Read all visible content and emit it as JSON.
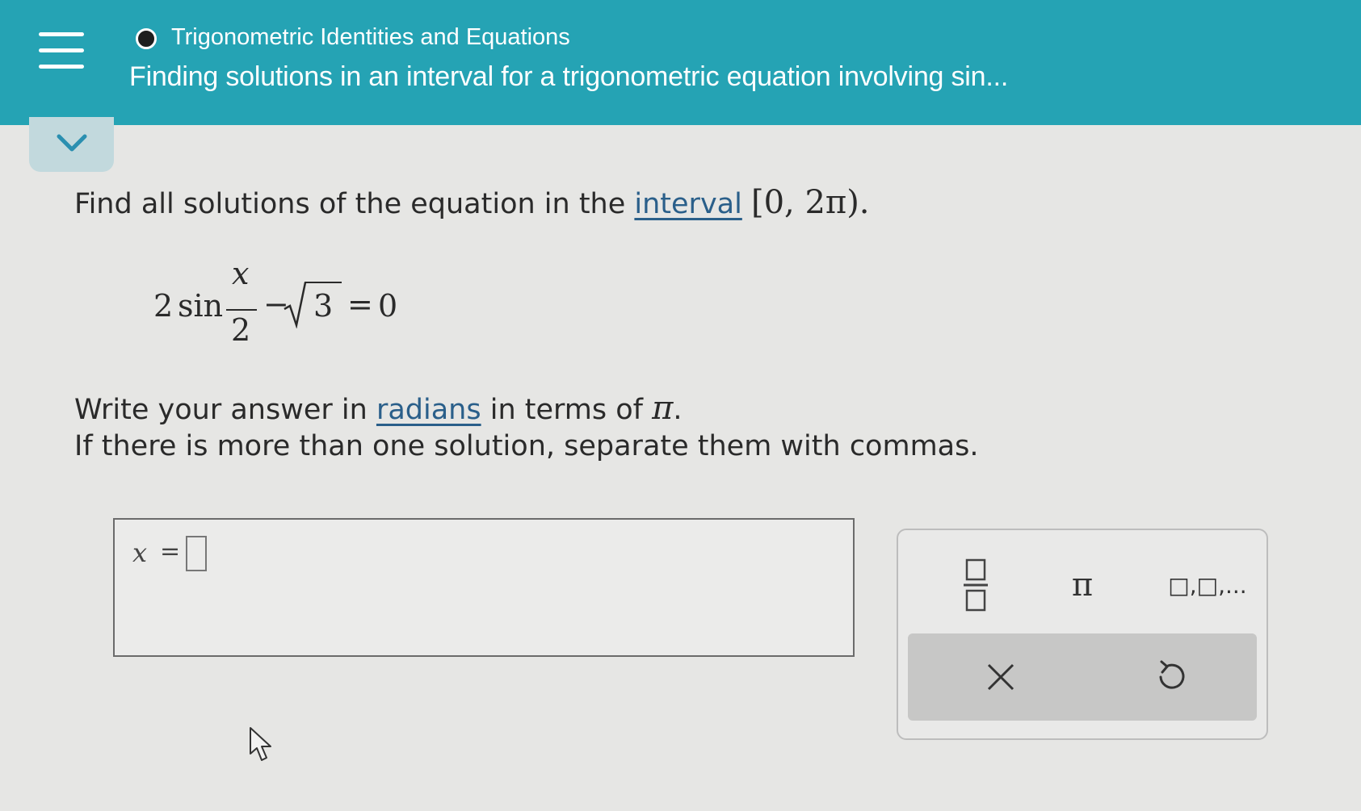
{
  "header": {
    "topic": "Trigonometric Identities and Equations",
    "lesson": "Finding solutions in an interval for a trigonometric equation involving sin..."
  },
  "problem": {
    "prompt_pre": "Find all solutions of the equation in the ",
    "prompt_link": "interval",
    "interval": "[0, 2π).",
    "equation": {
      "coef": "2",
      "func": "sin",
      "numerator": "x",
      "denominator": "2",
      "minus": "−",
      "radicand": "3",
      "equals": "=",
      "rhs": "0"
    },
    "instruction1_pre": "Write your answer in ",
    "instruction1_link": "radians",
    "instruction1_post": " in terms of ",
    "instruction1_pi": "π",
    "instruction1_end": ".",
    "instruction2": "If there is more than one solution, separate them with commas."
  },
  "answer": {
    "variable": "x",
    "equals": "=",
    "value": ""
  },
  "keypad": {
    "pi_label": "π",
    "list_label": "□,□,..."
  },
  "colors": {
    "header_bg": "#25a3b4",
    "page_bg": "#e6e6e4",
    "link": "#2a5f8a"
  }
}
